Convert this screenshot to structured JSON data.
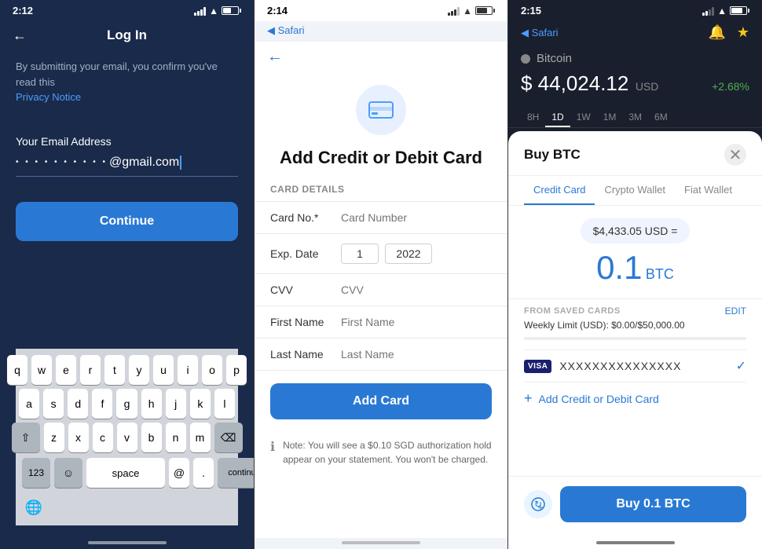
{
  "screen1": {
    "time": "2:12",
    "title": "Log In",
    "notice": "By submitting your email, you confirm you've read this",
    "privacy_link": "Privacy Notice",
    "email_label": "Your Email Address",
    "email_dots": "• • • • • • • • • •",
    "email_suffix": "@gmail.com",
    "continue_btn": "Continue",
    "keyboard": {
      "row1": [
        "q",
        "w",
        "e",
        "r",
        "t",
        "y",
        "u",
        "i",
        "o",
        "p"
      ],
      "row2": [
        "a",
        "s",
        "d",
        "f",
        "g",
        "h",
        "j",
        "k",
        "l"
      ],
      "row3": [
        "z",
        "x",
        "c",
        "v",
        "b",
        "n",
        "m"
      ],
      "bottom": {
        "num": "123",
        "emoji": "☺",
        "space": "space",
        "at": "@",
        "period": ".",
        "continue": "continue"
      }
    }
  },
  "screen2": {
    "time": "2:14",
    "safari_back": "◀ Safari",
    "title": "Add Credit or Debit Card",
    "card_details_label": "CARD DETAILS",
    "form": {
      "card_no_label": "Card No.*",
      "card_no_placeholder": "Card Number",
      "exp_date_label": "Exp. Date",
      "exp_month_value": "1",
      "exp_year_value": "2022",
      "cvv_label": "CVV",
      "cvv_placeholder": "CVV",
      "first_name_label": "First Name",
      "first_name_placeholder": "First Name",
      "last_name_label": "Last Name",
      "last_name_placeholder": "Last Name"
    },
    "add_card_btn": "Add Card",
    "note": "Note: You will see a $0.10 SGD authorization hold appear on your statement. You won't be charged."
  },
  "screen3": {
    "time": "2:15",
    "safari_back": "◀ Safari",
    "coin_name": "Bitcoin",
    "price": "$ 44,024.12",
    "currency": "USD",
    "change": "+2.68%",
    "chart_tabs": [
      "8H",
      "1D",
      "1W",
      "1M",
      "3M",
      "6M"
    ],
    "active_chart_tab": "1D",
    "modal": {
      "title": "Buy BTC",
      "tabs": [
        "Credit Card",
        "Crypto Wallet",
        "Fiat Wallet"
      ],
      "active_tab": "Credit Card",
      "usd_amount": "$4,433.05 USD =",
      "btc_amount": "0.1",
      "btc_unit": "BTC",
      "saved_cards_label": "FROM SAVED CARDS",
      "edit_label": "EDIT",
      "weekly_limit": "Weekly Limit (USD): $0.00/$50,000.00",
      "visa_number": "XXXXXXXXXXXXXXX",
      "add_card_text": "Add Credit or Debit Card",
      "buy_btn": "Buy 0.1 BTC"
    }
  }
}
